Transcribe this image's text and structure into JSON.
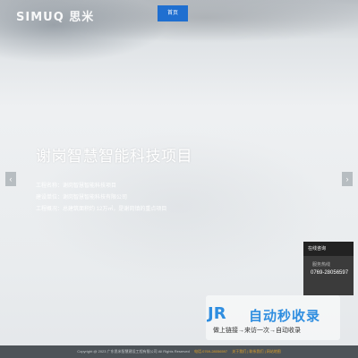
{
  "header": {
    "logo": "SIMUQ 思米",
    "nav": {
      "home_label": "首页"
    }
  },
  "slide": {
    "title": "谢岗智慧智能科技项目",
    "info": [
      "工程名称：谢岗智慧智能科技项目",
      "建设单位：谢岗智慧智能科技有限公司",
      "工程概况：总建筑面积约 12万㎡，是谢岗镇的重点项目"
    ],
    "prev_icon": "chevron-left-icon",
    "next_icon": "chevron-right-icon"
  },
  "contact": {
    "title": "在线咨询",
    "label": "服务热线",
    "phone": "0769-28056597"
  },
  "watermark": {
    "logo": "JR",
    "text": "自动秒收录",
    "sub": "做上链接→来访一次→自动收录"
  },
  "footer": {
    "copyright": "Copyright @ 2023 广东思米智慧建设工程有限公司 All Rights Reserved",
    "tel": "电话:0769-28056597",
    "links": "关于我们 | 联系我们 | 网站地图"
  },
  "colors": {
    "nav_active": "#1f6fd0",
    "footer_bg": "#4d5358",
    "contact_bg": "#3b3b3b",
    "watermark_blue": "#2f8ee0"
  }
}
